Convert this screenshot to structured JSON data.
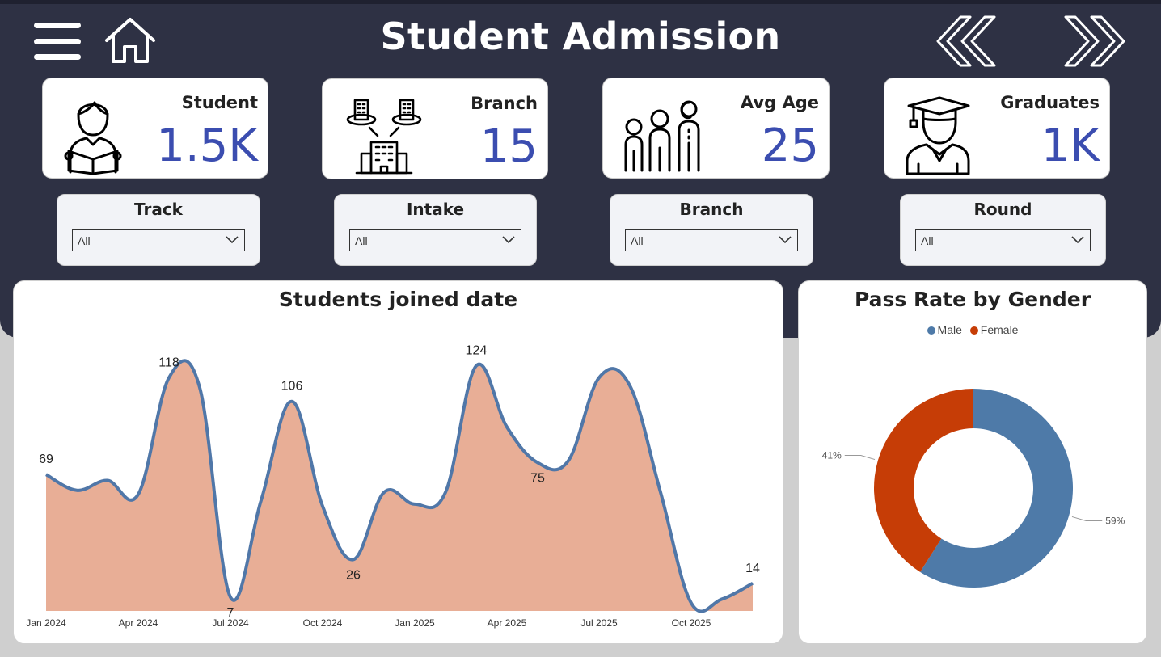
{
  "header": {
    "title": "Student Admission",
    "icons": [
      "menu-icon",
      "home-icon",
      "back-icon",
      "forward-icon"
    ]
  },
  "kpis": [
    {
      "label": "Student",
      "value": "1.5K",
      "icon": "student-reading-icon"
    },
    {
      "label": "Branch",
      "value": "15",
      "icon": "branch-buildings-icon"
    },
    {
      "label": "Avg Age",
      "value": "25",
      "icon": "family-age-icon"
    },
    {
      "label": "Graduates",
      "value": "1K",
      "icon": "graduate-icon"
    }
  ],
  "filters": [
    {
      "label": "Track",
      "value": "All"
    },
    {
      "label": "Intake",
      "value": "All"
    },
    {
      "label": "Branch",
      "value": "All"
    },
    {
      "label": "Round",
      "value": "All"
    }
  ],
  "colors": {
    "header_bg": "#2e3144",
    "kpi_value": "#3b4db0",
    "area_fill": "#e8ae96",
    "line": "#5077a8",
    "male": "#4e7aa8",
    "female": "#c63d06"
  },
  "chart_data": [
    {
      "type": "area",
      "title": "Students joined date",
      "x_tick_labels": [
        "Jan 2024",
        "Apr 2024",
        "Jul 2024",
        "Oct 2024",
        "Jan 2025",
        "Apr 2025",
        "Jul 2025",
        "Oct 2025"
      ],
      "x": [
        "Jan 2024",
        "Feb 2024",
        "Mar 2024",
        "Apr 2024",
        "May 2024",
        "Jun 2024",
        "Jul 2024",
        "Aug 2024",
        "Sep 2024",
        "Oct 2024",
        "Nov 2024",
        "Dec 2024",
        "Jan 2025",
        "Feb 2025",
        "Mar 2025",
        "Apr 2025",
        "May 2025",
        "Jun 2025",
        "Jul 2025",
        "Aug 2025",
        "Sep 2025",
        "Oct 2025",
        "Nov 2025",
        "Dec 2025"
      ],
      "values": [
        69,
        61,
        66,
        59,
        118,
        113,
        7,
        56,
        106,
        53,
        26,
        60,
        54,
        60,
        124,
        93,
        75,
        76,
        118,
        114,
        60,
        4,
        6,
        14
      ],
      "data_labels": [
        {
          "x": "Jan 2024",
          "value": 69
        },
        {
          "x": "May 2024",
          "value": 118
        },
        {
          "x": "Jul 2024",
          "value": 7
        },
        {
          "x": "Sep 2024",
          "value": 106
        },
        {
          "x": "Nov 2024",
          "value": 26
        },
        {
          "x": "Mar 2025",
          "value": 124
        },
        {
          "x": "May 2025",
          "value": 75
        },
        {
          "x": "Dec 2025",
          "value": 14
        }
      ],
      "xlabel": "",
      "ylabel": "",
      "ylim": [
        0,
        130
      ],
      "grid": false
    },
    {
      "type": "pie",
      "title": "Pass Rate by Gender",
      "donut": true,
      "legend_position": "top",
      "slices": [
        {
          "name": "Male",
          "value": 59,
          "label": "59%"
        },
        {
          "name": "Female",
          "value": 41,
          "label": "41%"
        }
      ]
    }
  ]
}
